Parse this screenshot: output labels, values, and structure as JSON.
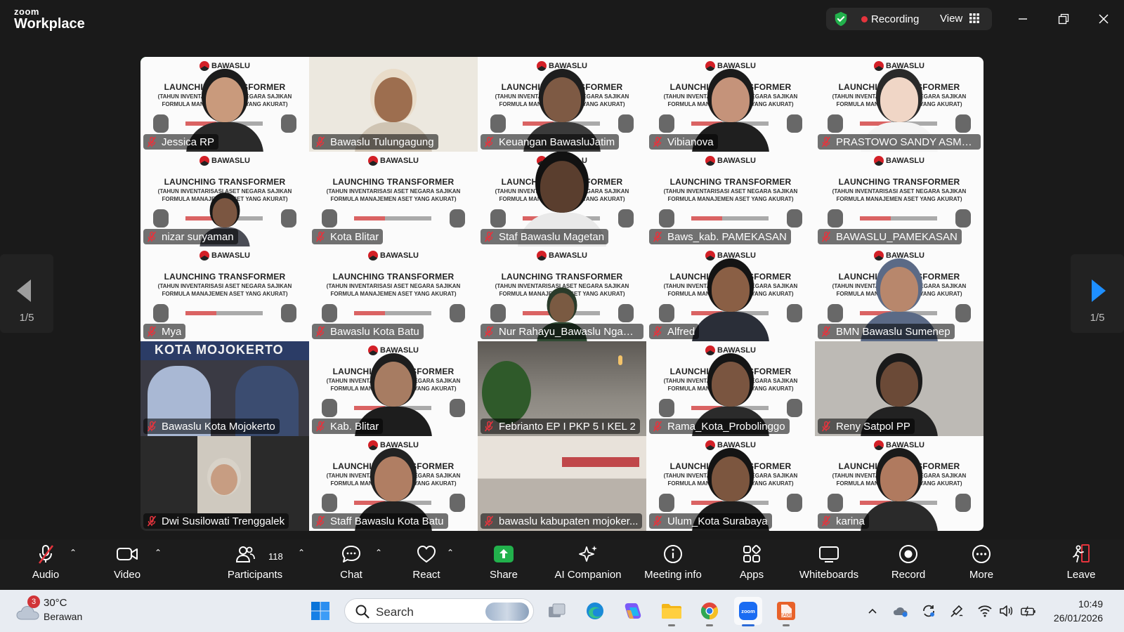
{
  "app": {
    "brand_top": "zoom",
    "brand_bottom": "Workplace"
  },
  "titlebar": {
    "recording_label": "Recording",
    "view_label": "View"
  },
  "pager": {
    "left_page": "1/5",
    "right_page": "1/5"
  },
  "poster": {
    "org": "BAWASLU",
    "title": "LAUNCHING TRANSFORMER",
    "subtitle": "(TAHUN INVENTARISASI ASET NEGARA SAJIKAN FORMULA MANAJEMEN ASET YANG AKURAT)"
  },
  "participants": [
    {
      "name": "Jessica RP",
      "type": "poster-person",
      "skin": "#c99a7c",
      "hair": "#1c1c1c",
      "cloth": "#2a2a2a",
      "active": true
    },
    {
      "name": "Bawaslu Tulungagung",
      "type": "room-person",
      "bg": "#ece8df",
      "skin": "#9d6e4f",
      "hair": "#e9dcc9",
      "cloth": "#cfc4b3"
    },
    {
      "name": "Keuangan BawasluJatim",
      "type": "poster-person",
      "skin": "#7e5a44",
      "hair": "#1e1e1e",
      "cloth": "#3b3b3b"
    },
    {
      "name": "Vibianova",
      "type": "poster-person",
      "skin": "#c5937a",
      "hair": "#1b1b1b",
      "cloth": "#1f1f1f"
    },
    {
      "name": "PRASTOWO SANDY ASMOR...",
      "type": "poster-person",
      "skin": "#f0d6c6",
      "hair": "#2a2a2a",
      "cloth": "#f4f4f4"
    },
    {
      "name": "nizar suryaman",
      "type": "poster-person",
      "skin": "#7b5641",
      "hair": "#161616",
      "cloth": "#4b4d56",
      "small": true
    },
    {
      "name": "Kota Blitar",
      "type": "poster"
    },
    {
      "name": "Staf Bawaslu Magetan",
      "type": "poster-person",
      "skin": "#5a3e2e",
      "hair": "#111",
      "cloth": "#e9e9e9",
      "big": true
    },
    {
      "name": "Baws_kab. PAMEKASAN",
      "type": "poster"
    },
    {
      "name": "BAWASLU_PAMEKASAN",
      "type": "poster"
    },
    {
      "name": "Mya",
      "type": "poster"
    },
    {
      "name": "Bawaslu Kota Batu",
      "type": "poster"
    },
    {
      "name": "Nur Rahayu_Bawaslu Nganj...",
      "type": "poster-person",
      "skin": "#7a5a42",
      "hair": "#2a3b2a",
      "cloth": "#2f4a33",
      "small": true
    },
    {
      "name": "Alfred",
      "type": "poster-person",
      "skin": "#8a5f45",
      "hair": "#141414",
      "cloth": "#2a2e38"
    },
    {
      "name": "BMN Bawaslu Sumenep",
      "type": "poster-person",
      "skin": "#b8876c",
      "hair": "#5b6a86",
      "cloth": "#5b6a86"
    },
    {
      "name": "Bawaslu Kota Mojokerto",
      "type": "mojokerto",
      "banner": "KOTA MOJOKERTO"
    },
    {
      "name": "Kab. Blitar",
      "type": "poster-person",
      "skin": "#a77c62",
      "hair": "#1d1d1d",
      "cloth": "#1d1d1d"
    },
    {
      "name": "Febrianto EP I PKP 5 I KEL 2",
      "type": "cafe"
    },
    {
      "name": "Rama_Kota_Probolinggo",
      "type": "poster-person",
      "skin": "#7a5540",
      "hair": "#151515",
      "cloth": "#2b2b2b"
    },
    {
      "name": "Reny Satpol PP",
      "type": "room-person",
      "bg": "#bdbab5",
      "skin": "#6b4a37",
      "hair": "#1a1a1a",
      "cloth": "#222"
    },
    {
      "name": "Dwi Susilowati Trenggalek",
      "type": "dark-portrait",
      "skin": "#c79d82",
      "hair": "#d8d2c8",
      "cloth": "#8d8a86"
    },
    {
      "name": "Staff Bawaslu Kota Batu",
      "type": "poster-person",
      "skin": "#b07e63",
      "hair": "#222",
      "cloth": "#222"
    },
    {
      "name": "bawaslu kabupaten mojoker...",
      "type": "office"
    },
    {
      "name": "Ulum_Kota Surabaya",
      "type": "poster-person",
      "skin": "#7c563f",
      "hair": "#141414",
      "cloth": "#1e1e1e"
    },
    {
      "name": "karina",
      "type": "poster-person",
      "skin": "#b07a5f",
      "hair": "#1a1a1a",
      "cloth": "#2a2a2a"
    }
  ],
  "toolbar": {
    "audio": "Audio",
    "video": "Video",
    "participants": "Participants",
    "participants_count": "118",
    "chat": "Chat",
    "react": "React",
    "share": "Share",
    "ai_companion": "AI Companion",
    "meeting_info": "Meeting info",
    "apps": "Apps",
    "whiteboards": "Whiteboards",
    "record": "Record",
    "more": "More",
    "leave": "Leave"
  },
  "taskbar": {
    "weather_badge": "3",
    "temperature": "30°C",
    "weather_desc": "Berawan",
    "search_placeholder": "Search",
    "time": "10:49",
    "date": "26/01/2026"
  }
}
